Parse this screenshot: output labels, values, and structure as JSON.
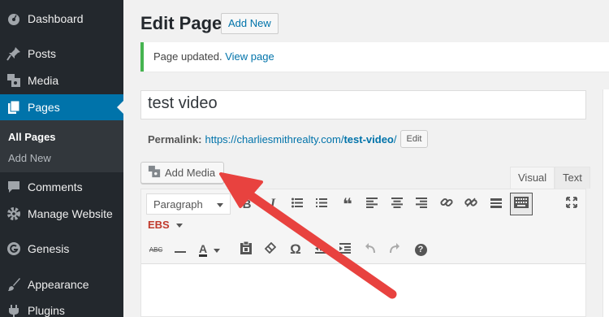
{
  "sidebar": {
    "items": [
      {
        "label": "Dashboard",
        "icon": "dashboard-icon"
      },
      {
        "label": "Posts",
        "icon": "pin-icon"
      },
      {
        "label": "Media",
        "icon": "media-icon"
      },
      {
        "label": "Pages",
        "icon": "pages-icon",
        "active": true
      },
      {
        "label": "Comments",
        "icon": "comment-icon"
      },
      {
        "label": "Manage Website",
        "icon": "gear-icon"
      },
      {
        "label": "Genesis",
        "icon": "genesis-icon"
      },
      {
        "label": "Appearance",
        "icon": "brush-icon"
      },
      {
        "label": "Plugins",
        "icon": "plugin-icon"
      }
    ],
    "submenu": [
      "All Pages",
      "Add New"
    ]
  },
  "header": {
    "title": "Edit Page",
    "add_new": "Add New"
  },
  "notice": {
    "text": "Page updated.",
    "link": "View page"
  },
  "post": {
    "title": "test video",
    "permalink_label": "Permalink:",
    "permalink_base": "https://charliesmithrealty.com/",
    "permalink_slug": "test-video",
    "permalink_end": "/",
    "edit_label": "Edit"
  },
  "editor": {
    "add_media": "Add Media",
    "tab_visual": "Visual",
    "tab_text": "Text",
    "format_value": "Paragraph",
    "ebs_label": "EBS",
    "bold_glyph": "B",
    "italic_glyph": "I",
    "quote_glyph": "❝",
    "omega_glyph": "Ω",
    "help_glyph": "?",
    "strike_glyph": "ABC",
    "textcolor_glyph": "A"
  },
  "colors": {
    "sidebar_bg": "#23282d",
    "active_bg": "#0073aa",
    "link": "#0073aa",
    "notice_border": "#46b450",
    "arrow": "#e8423f"
  }
}
